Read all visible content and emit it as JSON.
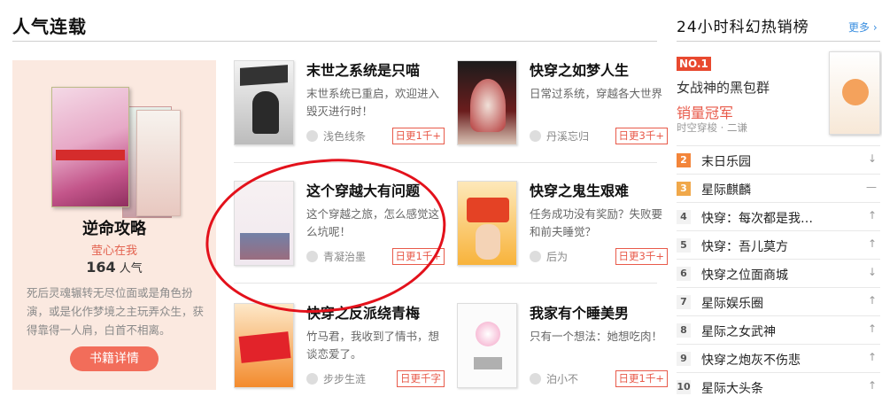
{
  "section": {
    "title": "人气连载"
  },
  "feature": {
    "title": "逆命攻略",
    "author": "莹心在我",
    "popularity_value": "164",
    "popularity_unit": "人气",
    "description": "死后灵魂辗转无尽位面或是角色扮演，或是化作梦境之主玩弄众生，获得靠得一人肩，白首不相离。",
    "button": "书籍详情"
  },
  "books": [
    {
      "title": "末世之系统是只喵",
      "desc": "末世系统已重启，欢迎进入毁灭进行时！",
      "author": "浅色线条",
      "tag": "日更1千+"
    },
    {
      "title": "快穿之如梦人生",
      "desc": "日常过系统，穿越各大世界",
      "author": "丹溪忘归",
      "tag": "日更3千+"
    },
    {
      "title": "这个穿越大有问题",
      "desc": "这个穿越之旅，怎么感觉这么坑呢！",
      "author": "青凝治墨",
      "tag": "日更1千+"
    },
    {
      "title": "快穿之鬼生艰难",
      "desc": "任务成功没有奖励？失败要和前夫睡觉？",
      "author": "后为",
      "tag": "日更3千+"
    },
    {
      "title": "快穿之反派绕青梅",
      "desc": "竹马君，我收到了情书，想谈恋爱了。",
      "author": "步步生涟",
      "tag": "日更千字"
    },
    {
      "title": "我家有个睡美男",
      "desc": "只有一个想法：她想吃肉！",
      "author": "泊小不",
      "tag": "日更1千+"
    }
  ],
  "ranking": {
    "title": "24小时科幻热销榜",
    "more": "更多 ›",
    "top": {
      "badge": "NO.1",
      "name": "女战神的黑包群",
      "label": "销量冠军",
      "category": "时空穿梭 · 二谦"
    },
    "items": [
      {
        "num": "2",
        "name": "末日乐园",
        "trend": "↓"
      },
      {
        "num": "3",
        "name": "星际麒麟",
        "trend": "—"
      },
      {
        "num": "4",
        "name": "快穿：每次都是我…",
        "trend": "↑"
      },
      {
        "num": "5",
        "name": "快穿：吾儿莫方",
        "trend": "↑"
      },
      {
        "num": "6",
        "name": "快穿之位面商城",
        "trend": "↓"
      },
      {
        "num": "7",
        "name": "星际娱乐圈",
        "trend": "↑"
      },
      {
        "num": "8",
        "name": "星际之女武神",
        "trend": "↑"
      },
      {
        "num": "9",
        "name": "快穿之炮灰不伤悲",
        "trend": "↑"
      },
      {
        "num": "10",
        "name": "星际大头条",
        "trend": "↑"
      }
    ]
  }
}
